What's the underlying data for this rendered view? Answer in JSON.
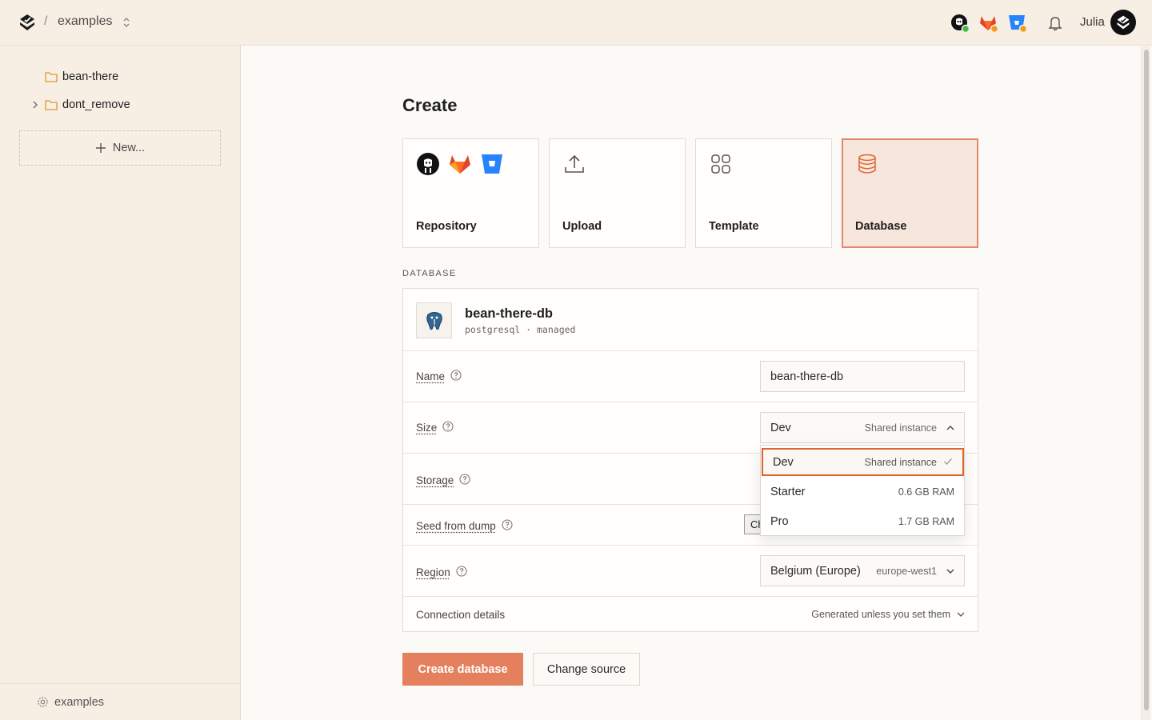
{
  "header": {
    "separator": "/",
    "project": "examples",
    "user": "Julia",
    "icons": [
      "github-icon",
      "gitlab-icon",
      "bitbucket-icon",
      "bell-icon"
    ]
  },
  "sidebar": {
    "items": [
      {
        "label": "bean-there"
      },
      {
        "label": "dont_remove"
      }
    ],
    "new_label": "New...",
    "footer_label": "examples"
  },
  "main": {
    "title": "Create",
    "sources": [
      {
        "label": "Repository",
        "icon": "repository-providers-icon"
      },
      {
        "label": "Upload",
        "icon": "upload-icon"
      },
      {
        "label": "Template",
        "icon": "template-grid-icon"
      },
      {
        "label": "Database",
        "icon": "database-icon",
        "selected": true
      }
    ],
    "section_label": "DATABASE",
    "db": {
      "name": "bean-there-db",
      "meta": "postgresql · managed"
    },
    "fields": {
      "name": {
        "label": "Name",
        "value": "bean-there-db"
      },
      "size": {
        "label": "Size",
        "value": "Dev",
        "hint": "Shared instance"
      },
      "storage": {
        "label": "Storage"
      },
      "seed": {
        "label": "Seed from dump",
        "button_peek": "Ch"
      },
      "region": {
        "label": "Region",
        "value": "Belgium (Europe)",
        "hint": "europe-west1"
      }
    },
    "size_options": [
      {
        "label": "Dev",
        "hint": "Shared instance",
        "selected": true
      },
      {
        "label": "Starter",
        "hint": "0.6 GB RAM"
      },
      {
        "label": "Pro",
        "hint": "1.7 GB RAM"
      }
    ],
    "connection": {
      "label": "Connection details",
      "hint": "Generated unless you set them"
    },
    "actions": {
      "create": "Create database",
      "change_source": "Change source"
    }
  },
  "colors": {
    "accent": "#e5805e",
    "accent_border": "#e0622f",
    "sidebar_bg": "#f8efe4",
    "selected_card_bg": "#f7e6dc"
  }
}
